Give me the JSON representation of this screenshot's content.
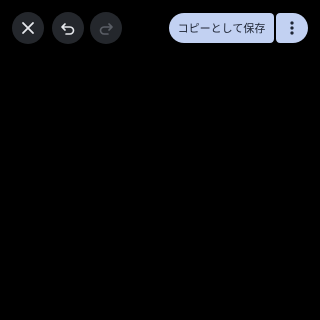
{
  "toolbar": {
    "close": {
      "icon": "close-icon"
    },
    "undo": {
      "icon": "undo-icon"
    },
    "redo": {
      "icon": "redo-icon",
      "enabled": false
    },
    "save_copy_label": "コピーとして保存",
    "more": {
      "icon": "more-vert-icon"
    }
  },
  "colors": {
    "background": "#000000",
    "circle_button_bg": "#24272c",
    "icon_active": "#e6e8ec",
    "icon_disabled": "#5b5f66",
    "primary_button_bg": "#c2d1f2",
    "primary_button_text": "#1d2433"
  }
}
